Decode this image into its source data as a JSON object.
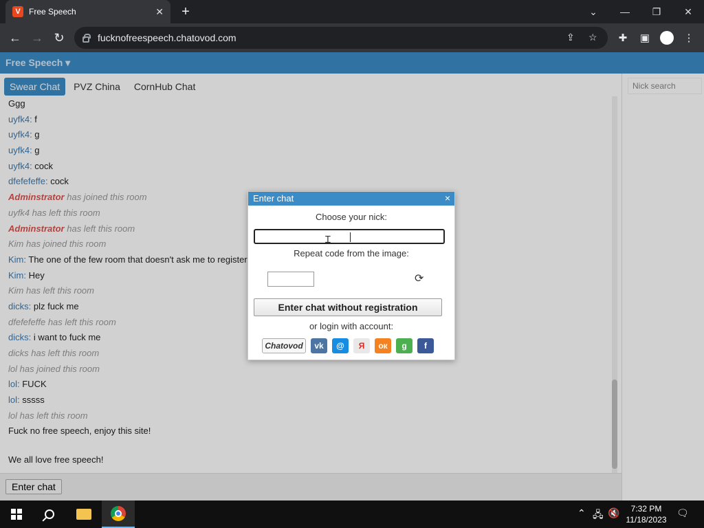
{
  "browser": {
    "tab_title": "Free Speech",
    "favicon_letter": "V",
    "url": "fucknofreespeech.chatovod.com"
  },
  "site": {
    "title": "Free Speech ▾",
    "rooms": [
      "Swear Chat",
      "PVZ China",
      "CornHub Chat"
    ],
    "nick_search_placeholder": "Nick search",
    "enter_chat_label": "Enter chat"
  },
  "messages": [
    {
      "nick": "",
      "text": "Ggg",
      "type": "msg"
    },
    {
      "nick": "uyfk4:",
      "text": " f",
      "type": "msg"
    },
    {
      "nick": "uyfk4:",
      "text": " g",
      "type": "msg"
    },
    {
      "nick": "uyfk4:",
      "text": " g",
      "type": "msg"
    },
    {
      "nick": "uyfk4:",
      "text": " cock",
      "type": "msg"
    },
    {
      "nick": "dfefefeffe:",
      "text": " cock",
      "type": "msg"
    },
    {
      "nick": "Adminstrator",
      "text": " has joined this room",
      "type": "admin"
    },
    {
      "nick": "",
      "text": "uyfk4 has left this room",
      "type": "sys"
    },
    {
      "nick": "Adminstrator",
      "text": " has left this room",
      "type": "admin"
    },
    {
      "nick": "",
      "text": "Kim has joined this room",
      "type": "sys"
    },
    {
      "nick": "Kim:",
      "text": " The one of the few room that doesn't ask me to register",
      "type": "msg"
    },
    {
      "nick": "Kim:",
      "text": " Hey",
      "type": "msg"
    },
    {
      "nick": "",
      "text": "Kim has left this room",
      "type": "sys"
    },
    {
      "nick": "dicks:",
      "text": " plz fuck me",
      "type": "msg"
    },
    {
      "nick": "",
      "text": "dfefefeffe has left this room",
      "type": "sys"
    },
    {
      "nick": "dicks:",
      "text": " i want to fuck me",
      "type": "msg"
    },
    {
      "nick": "",
      "text": "dicks has left this room",
      "type": "sys"
    },
    {
      "nick": "",
      "text": "lol has joined this room",
      "type": "sys"
    },
    {
      "nick": "lol:",
      "text": " FUCK",
      "type": "msg"
    },
    {
      "nick": "lol:",
      "text": " sssss",
      "type": "msg"
    },
    {
      "nick": "",
      "text": "lol has left this room",
      "type": "sys"
    },
    {
      "nick": "",
      "text": "Fuck no free speech, enjoy this site!",
      "type": "msg"
    },
    {
      "nick": "",
      "text": "",
      "type": "spacer"
    },
    {
      "nick": "",
      "text": "We all love free speech!",
      "type": "msg"
    }
  ],
  "dialog": {
    "title": "Enter chat",
    "close_glyph": "×",
    "nick_label": "Choose your nick:",
    "code_label": "Repeat code from the image:",
    "register_button": "Enter chat without registration",
    "login_label": "or login with account:",
    "chatovod_label": "Chatovod",
    "socials": [
      {
        "name": "vk",
        "glyph": "vk",
        "color": "#4c75a3"
      },
      {
        "name": "mailru",
        "glyph": "@",
        "color": "#168de2"
      },
      {
        "name": "yandex",
        "glyph": "Я",
        "color": "#e8e8e8"
      },
      {
        "name": "odnoklassniki",
        "glyph": "ок",
        "color": "#f58220"
      },
      {
        "name": "google",
        "glyph": "g",
        "color": "#4caf50"
      },
      {
        "name": "facebook",
        "glyph": "f",
        "color": "#3b5998"
      }
    ]
  },
  "taskbar": {
    "time": "7:32 PM",
    "date": "11/18/2023"
  }
}
